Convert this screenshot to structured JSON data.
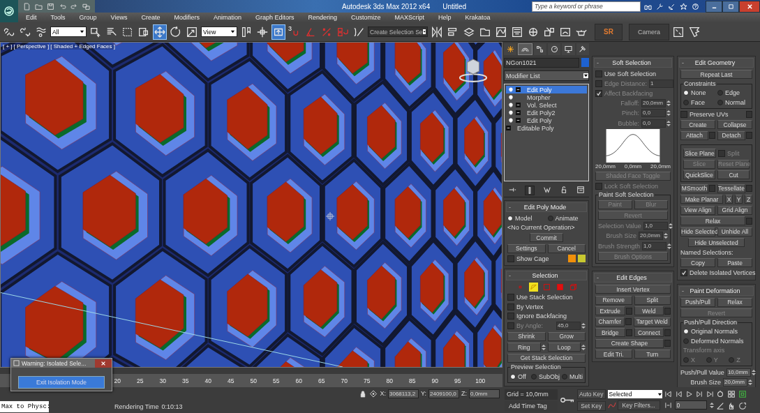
{
  "window": {
    "title": "Autodesk 3ds Max  2012 x64",
    "document": "Untitled",
    "search": {
      "placeholder": "Type a keyword or phrase"
    }
  },
  "menu": [
    "Edit",
    "Tools",
    "Group",
    "Views",
    "Create",
    "Modifiers",
    "Animation",
    "Graph Editors",
    "Rendering",
    "Customize",
    "MAXScript",
    "Help",
    "Krakatoa"
  ],
  "main_toolbar": [
    {
      "kind": "link",
      "selected": false
    },
    {
      "kind": "unlink",
      "selected": false
    },
    {
      "kind": "bind",
      "selected": false
    },
    {
      "kind": "dropdown",
      "value": "All",
      "selected": false
    },
    {
      "kind": "select",
      "selected": false
    },
    {
      "kind": "select_by_name",
      "selected": false
    },
    {
      "kind": "region",
      "selected": false
    },
    {
      "kind": "crossing",
      "selected": false
    },
    {
      "kind": "move",
      "selected": true
    },
    {
      "kind": "rotate",
      "selected": false
    },
    {
      "kind": "scale",
      "selected": false
    },
    {
      "kind": "dropdown",
      "value": "View",
      "selected": false
    },
    {
      "kind": "pivot",
      "selected": false
    },
    {
      "kind": "manipulate",
      "selected": false
    },
    {
      "kind": "override",
      "selected": true
    },
    {
      "kind": "snap",
      "label": "3",
      "selected": false
    },
    {
      "kind": "angle_snap",
      "selected": false
    },
    {
      "kind": "percent_snap",
      "selected": false
    },
    {
      "kind": "spinner_snap",
      "selected": false
    },
    {
      "kind": "named_sets",
      "selected": false
    },
    {
      "kind": "dropdown",
      "value": "Create Selection Se",
      "selected": false
    },
    {
      "kind": "mirror",
      "selected": false
    },
    {
      "kind": "align",
      "selected": false
    },
    {
      "kind": "layers",
      "selected": false
    },
    {
      "kind": "ribbon",
      "selected": false
    },
    {
      "kind": "curve_editor",
      "selected": false
    },
    {
      "kind": "schematic",
      "selected": false
    },
    {
      "kind": "material",
      "selected": false
    },
    {
      "kind": "render_setup",
      "selected": false
    },
    {
      "kind": "frame_window",
      "selected": false
    },
    {
      "kind": "teapot",
      "selected": false
    },
    {
      "kind": "text_button",
      "label": "SR",
      "selected": false
    },
    {
      "kind": "text_button",
      "label": "Camera",
      "selected": false
    },
    {
      "kind": "plugin",
      "selected": false
    },
    {
      "kind": "corner",
      "selected": false
    }
  ],
  "viewport": {
    "labels": [
      "[ + ]",
      "[ Perspective ]",
      "[ Shaded + Edged Faces ]"
    ]
  },
  "command_panel": {
    "tabs": [
      {
        "kind": "create",
        "selected": false
      },
      {
        "kind": "modify",
        "selected": true
      },
      {
        "kind": "hierarchy",
        "selected": false
      },
      {
        "kind": "motion",
        "selected": false
      },
      {
        "kind": "display",
        "selected": false
      },
      {
        "kind": "utilities",
        "selected": false
      }
    ],
    "object_name": "NGon1021",
    "modifier_list": "Modifier List",
    "stack": [
      {
        "kind": "modifier",
        "label": "Edit Poly",
        "expandable": true,
        "selected": true
      },
      {
        "kind": "modifier",
        "label": "Morpher",
        "expandable": false,
        "selected": false
      },
      {
        "kind": "modifier",
        "label": "Vol. Select",
        "expandable": true,
        "selected": false
      },
      {
        "kind": "modifier",
        "label": "Edit Poly2",
        "expandable": true,
        "selected": false
      },
      {
        "kind": "modifier",
        "label": "Edit Poly",
        "expandable": true,
        "selected": false
      },
      {
        "kind": "base",
        "label": "Editable Poly",
        "expandable": true,
        "selected": false
      }
    ],
    "rollout_columns": [
      [
        {
          "title": "Edit Poly Mode",
          "sign": "-",
          "rows": [
            [
              {
                "kind": "radio",
                "label": "Model",
                "selected": true
              },
              {
                "kind": "radio",
                "label": "Animate",
                "selected": false
              }
            ],
            [
              {
                "kind": "text",
                "label": "<No Current Operation>"
              }
            ],
            [
              {
                "kind": "button_short",
                "label": "Commit"
              }
            ],
            [
              {
                "kind": "button",
                "label": "Settings"
              },
              {
                "kind": "button",
                "label": "Cancel"
              }
            ],
            [
              {
                "kind": "checkbox",
                "label": "Show Cage",
                "checked": false
              },
              {
                "kind": "swatch",
                "color": "#f0900a"
              },
              {
                "kind": "swatch",
                "color": "#c8c830"
              }
            ]
          ]
        },
        {
          "title": "Selection",
          "sign": "-",
          "rows": [
            [
              {
                "kind": "subobject",
                "items": [
                  {
                    "kind": "vertex",
                    "selected": false
                  },
                  {
                    "kind": "edge",
                    "selected": true
                  },
                  {
                    "kind": "border",
                    "selected": false
                  },
                  {
                    "kind": "polygon",
                    "selected": false
                  },
                  {
                    "kind": "element",
                    "selected": false
                  }
                ]
              }
            ],
            [
              {
                "kind": "checkbox",
                "label": "Use Stack Selection",
                "checked": false
              }
            ],
            [
              {
                "kind": "checkbox",
                "label": "By Vertex",
                "checked": false
              }
            ],
            [
              {
                "kind": "checkbox",
                "label": "Ignore Backfacing",
                "checked": false
              }
            ],
            [
              {
                "kind": "checkbox",
                "label": "By Angle:",
                "checked": false,
                "disabled": true
              },
              {
                "kind": "spinner",
                "value": "45,0",
                "disabled": true
              }
            ],
            [
              {
                "kind": "button",
                "label": "Shrink"
              },
              {
                "kind": "button",
                "label": "Grow"
              }
            ],
            [
              {
                "kind": "button_spinner",
                "label": "Ring"
              },
              {
                "kind": "button_spinner",
                "label": "Loop"
              }
            ],
            [
              {
                "kind": "button",
                "label": "Get Stack Selection"
              }
            ],
            [
              {
                "kind": "group",
                "title": "Preview Selection",
                "rows": [
                  [
                    {
                      "kind": "radio",
                      "label": "Off",
                      "selected": true
                    },
                    {
                      "kind": "radio",
                      "label": "SubObj",
                      "selected": false
                    },
                    {
                      "kind": "radio",
                      "label": "Multi",
                      "selected": false
                    }
                  ]
                ]
              }
            ]
          ]
        }
      ],
      [
        {
          "title": "Soft Selection",
          "sign": "-",
          "rows": [
            [
              {
                "kind": "checkbox",
                "label": "Use Soft Selection",
                "checked": false
              }
            ],
            [
              {
                "kind": "checkbox",
                "label": "Edge Distance:",
                "checked": false,
                "disabled": true
              },
              {
                "kind": "spinner",
                "value": "1",
                "disabled": true
              }
            ],
            [
              {
                "kind": "checkbox",
                "label": "Affect Backfacing",
                "checked": true,
                "disabled": true
              }
            ],
            [
              {
                "kind": "spinner",
                "label": "Falloff:",
                "value": "20,0mm",
                "disabled": true
              }
            ],
            [
              {
                "kind": "spinner",
                "label": "Pinch:",
                "value": "0,0",
                "disabled": true
              }
            ],
            [
              {
                "kind": "spinner",
                "label": "Bubble:",
                "value": "0,0",
                "disabled": true
              }
            ],
            [
              {
                "kind": "falloff_curve",
                "labels": [
                  "20,0mm",
                  "0,0mm",
                  "20,0mm"
                ]
              }
            ],
            [
              {
                "kind": "button",
                "label": "Shaded Face Toggle",
                "disabled": true
              }
            ],
            [
              {
                "kind": "checkbox",
                "label": "Lock Soft Selection",
                "checked": false,
                "disabled": true
              }
            ],
            [
              {
                "kind": "group",
                "title": "Paint Soft Selection",
                "rows": [
                  [
                    {
                      "kind": "button",
                      "label": "Paint",
                      "disabled": true
                    },
                    {
                      "kind": "button",
                      "label": "Blur",
                      "disabled": true
                    }
                  ],
                  [
                    {
                      "kind": "button",
                      "label": "Revert",
                      "disabled": true
                    }
                  ],
                  [
                    {
                      "kind": "spinner",
                      "label": "Selection Value",
                      "value": "1,0",
                      "disabled": true
                    }
                  ],
                  [
                    {
                      "kind": "spinner",
                      "label": "Brush Size",
                      "value": "20,0mm",
                      "disabled": true
                    }
                  ],
                  [
                    {
                      "kind": "spinner",
                      "label": "Brush Strength",
                      "value": "1,0",
                      "disabled": true
                    }
                  ],
                  [
                    {
                      "kind": "button",
                      "label": "Brush Options",
                      "disabled": true
                    }
                  ]
                ]
              }
            ]
          ]
        },
        {
          "title": "Edit Edges",
          "sign": "-",
          "rows": [
            [
              {
                "kind": "button",
                "label": "Insert Vertex"
              }
            ],
            [
              {
                "kind": "button",
                "label": "Remove"
              },
              {
                "kind": "button",
                "label": "Split"
              }
            ],
            [
              {
                "kind": "button_settings",
                "label": "Extrude"
              },
              {
                "kind": "button_settings",
                "label": "Weld"
              }
            ],
            [
              {
                "kind": "button_settings",
                "label": "Chamfer"
              },
              {
                "kind": "button",
                "label": "Target Weld"
              }
            ],
            [
              {
                "kind": "button_settings",
                "label": "Bridge"
              },
              {
                "kind": "button_settings",
                "label": "Connect"
              }
            ],
            [
              {
                "kind": "button_settings",
                "label": "Create Shape"
              }
            ],
            [
              {
                "kind": "button",
                "label": "Edit Tri."
              },
              {
                "kind": "button",
                "label": "Turn"
              }
            ]
          ]
        }
      ],
      [
        {
          "title": "Edit Geometry",
          "sign": "-",
          "rows": [
            [
              {
                "kind": "button",
                "label": "Repeat Last"
              }
            ],
            [
              {
                "kind": "group",
                "title": "Constraints",
                "rows": [
                  [
                    {
                      "kind": "radio",
                      "label": "None",
                      "selected": true
                    },
                    {
                      "kind": "radio",
                      "label": "Edge",
                      "selected": false
                    }
                  ],
                  [
                    {
                      "kind": "radio",
                      "label": "Face",
                      "selected": false
                    },
                    {
                      "kind": "radio",
                      "label": "Normal",
                      "selected": false
                    }
                  ]
                ]
              }
            ],
            [
              {
                "kind": "checkbox_settings",
                "label": "Preserve UVs",
                "checked": false
              }
            ],
            [
              {
                "kind": "button",
                "label": "Create"
              },
              {
                "kind": "button",
                "label": "Collapse"
              }
            ],
            [
              {
                "kind": "button_settings",
                "label": "Attach"
              },
              {
                "kind": "button_settings",
                "label": "Detach"
              }
            ],
            [
              {
                "kind": "group",
                "rows": [
                  [
                    {
                      "kind": "button",
                      "label": "Slice Plane"
                    },
                    {
                      "kind": "checkbox",
                      "label": "Split",
                      "checked": false,
                      "disabled": true
                    }
                  ],
                  [
                    {
                      "kind": "button",
                      "label": "Slice",
                      "disabled": true
                    },
                    {
                      "kind": "button",
                      "label": "Reset Plane",
                      "disabled": true
                    }
                  ],
                  [
                    {
                      "kind": "button",
                      "label": "QuickSlice"
                    },
                    {
                      "kind": "button",
                      "label": "Cut"
                    }
                  ]
                ]
              }
            ],
            [
              {
                "kind": "button_settings",
                "label": "MSmooth"
              },
              {
                "kind": "button_settings",
                "label": "Tessellate"
              }
            ],
            [
              {
                "kind": "button",
                "label": "Make Planar"
              },
              {
                "kind": "button_axis",
                "label": "X"
              },
              {
                "kind": "button_axis",
                "label": "Y"
              },
              {
                "kind": "button_axis",
                "label": "Z"
              }
            ],
            [
              {
                "kind": "button",
                "label": "View Align"
              },
              {
                "kind": "button",
                "label": "Grid Align"
              }
            ],
            [
              {
                "kind": "button_settings",
                "label": "Relax"
              }
            ],
            [
              {
                "kind": "button",
                "label": "Hide Selected"
              },
              {
                "kind": "button",
                "label": "Unhide All"
              }
            ],
            [
              {
                "kind": "button_short",
                "label": "Hide Unselected"
              }
            ],
            [
              {
                "kind": "text",
                "label": "Named Selections:"
              }
            ],
            [
              {
                "kind": "button",
                "label": "Copy"
              },
              {
                "kind": "button",
                "label": "Paste"
              }
            ],
            [
              {
                "kind": "checkbox",
                "label": "Delete Isolated Vertices",
                "checked": true
              }
            ]
          ]
        },
        {
          "title": "Paint Deformation",
          "sign": "-",
          "rows": [
            [
              {
                "kind": "button",
                "label": "Push/Pull"
              },
              {
                "kind": "button",
                "label": "Relax"
              }
            ],
            [
              {
                "kind": "button",
                "label": "Revert",
                "disabled": true
              }
            ],
            [
              {
                "kind": "group",
                "title": "Push/Pull Direction",
                "rows": [
                  [
                    {
                      "kind": "radio",
                      "label": "Original Normals",
                      "selected": true
                    }
                  ],
                  [
                    {
                      "kind": "radio",
                      "label": "Deformed Normals",
                      "selected": false
                    }
                  ],
                  [
                    {
                      "kind": "text",
                      "label": "Transform axis",
                      "disabled": true
                    }
                  ],
                  [
                    {
                      "kind": "radio",
                      "label": "X",
                      "selected": false,
                      "disabled": true
                    },
                    {
                      "kind": "radio",
                      "label": "Y",
                      "selected": false,
                      "disabled": true
                    },
                    {
                      "kind": "radio",
                      "label": "Z",
                      "selected": false,
                      "disabled": true
                    }
                  ]
                ]
              }
            ],
            [
              {
                "kind": "spinner",
                "label": "Push/Pull Value",
                "value": "10,0mm"
              }
            ],
            [
              {
                "kind": "spinner",
                "label": "Brush Size",
                "value": "20,0mm"
              }
            ]
          ]
        }
      ]
    ]
  },
  "timeline": {
    "ticks": [
      "20",
      "25",
      "30",
      "35",
      "40",
      "45",
      "50",
      "55",
      "60",
      "65",
      "70",
      "75",
      "80",
      "85",
      "90",
      "95",
      "100"
    ]
  },
  "status": {
    "coords": [
      {
        "axis": "X:",
        "value": "3068113,2"
      },
      {
        "axis": "Y:",
        "value": "2409100,0"
      },
      {
        "axis": "Z:",
        "value": "0,0mm"
      }
    ],
    "script_listener": "Max to Physc:",
    "rendering_time_label": "Rendering Time",
    "rendering_time": "0:10:13",
    "grid": "Grid = 10,0mm",
    "time_tag": "Add Time Tag",
    "auto_key": "Auto Key",
    "set_key": "Set Key",
    "key_mode": "Selected",
    "key_filters": "Key Filters...",
    "frame": "0"
  },
  "dialog": {
    "title": "Warning: Isolated Sele...",
    "button": "Exit Isolation Mode"
  }
}
